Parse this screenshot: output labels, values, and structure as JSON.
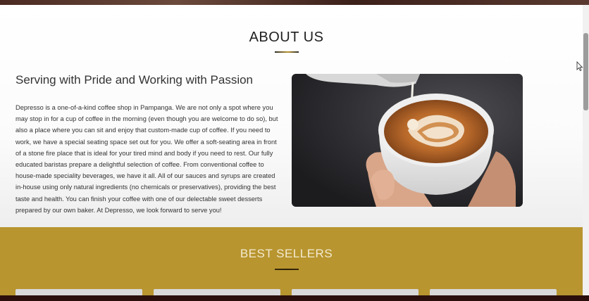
{
  "about": {
    "title": "ABOUT US",
    "subheading": "Serving with Pride and Working with Passion",
    "description": "Depresso is a one-of-a-kind coffee shop in Pampanga. We are not only a spot where you may stop in for a cup of coffee in the morning (even though you are welcome to do so), but also a place where you can sit and enjoy that custom-made cup of coffee. If you need to work, we have a special seating space set out for you. We offer a soft-seating area in front of a stone fire place that is ideal for your tired mind and body if you need to rest. Our fully educated baristas prepare a delightful selection of coffee. From conventional coffee to house-made speciality beverages, we have it all. All of our sauces and syrups are created in-house using only natural ingredients (no chemicals or preservatives), providing the best taste and health. You can finish your coffee with one of our delectable sweet desserts prepared by our own baker. At Depresso, we look forward to serve you!",
    "image_icon": "latte-art-photo"
  },
  "best_sellers": {
    "title": "BEST SELLERS"
  },
  "colors": {
    "accent_gold": "#b8952f",
    "heading_text": "#1f1f1f",
    "body_text": "#333333"
  }
}
